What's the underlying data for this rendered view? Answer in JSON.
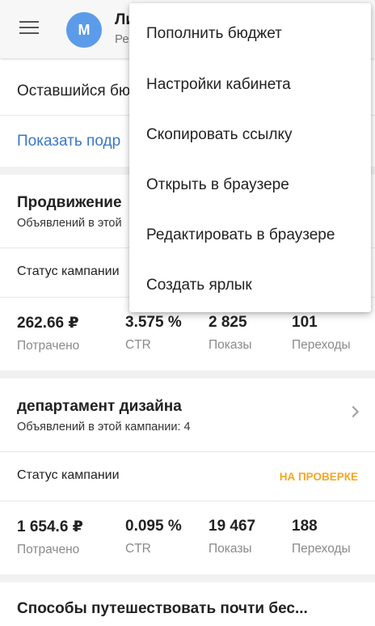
{
  "appbar": {
    "menu_icon": "hamburger-menu-icon",
    "avatar_letter": "М",
    "avatar_color": "#5b9bea",
    "account_name": "Ли",
    "account_subtitle": "Ре"
  },
  "budget": {
    "label": "Оставшийся бю",
    "details_link": "Показать подр"
  },
  "campaigns": [
    {
      "title": "Продвижение",
      "ads_count": "Объявлений в этой",
      "status_label": "Статус кампании",
      "status_value": "",
      "stats": [
        {
          "value": "262.66 ₽",
          "label": "Потрачено"
        },
        {
          "value": "3.575 %",
          "label": "CTR"
        },
        {
          "value": "2 825",
          "label": "Показы"
        },
        {
          "value": "101",
          "label": "Переходы"
        }
      ]
    },
    {
      "title": "департамент дизайна",
      "ads_count": "Объявлений в этой кампании: 4",
      "status_label": "Статус кампании",
      "status_value": "НА ПРОВЕРКЕ",
      "stats": [
        {
          "value": "1 654.6 ₽",
          "label": "Потрачено"
        },
        {
          "value": "0.095 %",
          "label": "CTR"
        },
        {
          "value": "19 467",
          "label": "Показы"
        },
        {
          "value": "188",
          "label": "Переходы"
        }
      ]
    }
  ],
  "bottom_campaign": {
    "title": "Способы путешествовать почти бес..."
  },
  "dropdown_menu": {
    "items": [
      "Пополнить бюджет",
      "Настройки кабинета",
      "Скопировать ссылку",
      "Открыть в браузере",
      "Редактировать в браузере",
      "Создать ярлык"
    ]
  },
  "colors": {
    "accent_link": "#3a77c8",
    "status_pending": "#f5a623"
  }
}
